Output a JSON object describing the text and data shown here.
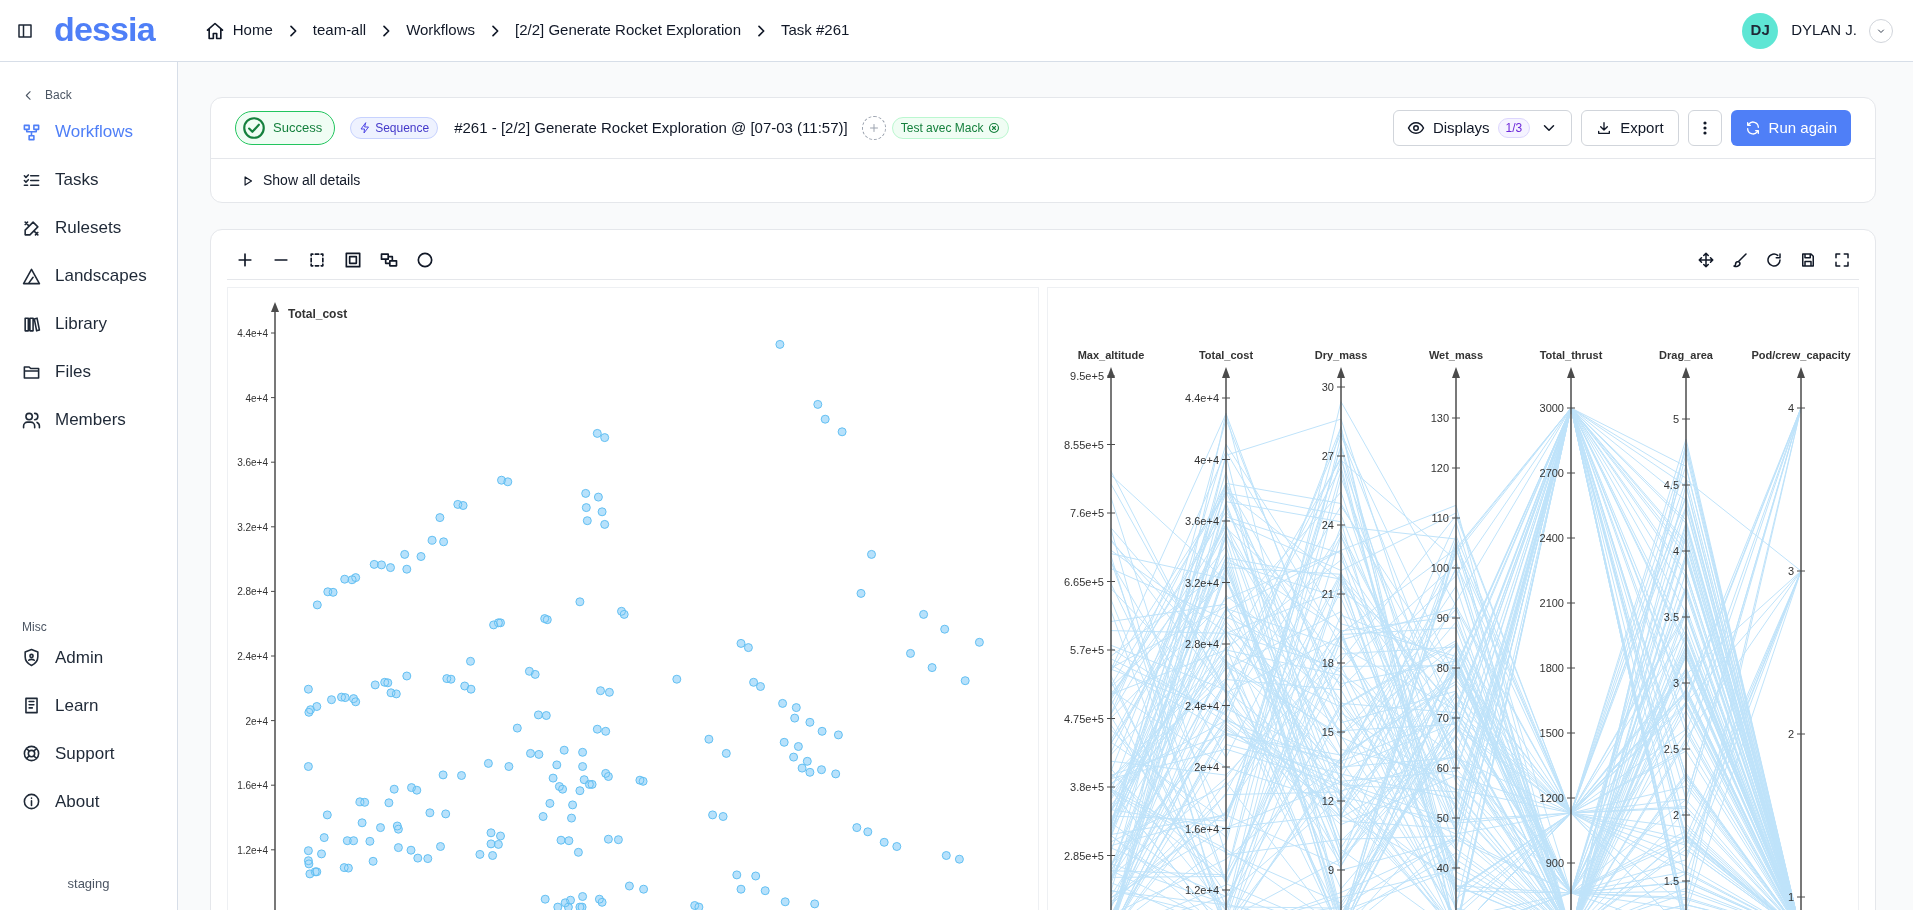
{
  "header": {
    "logo": "dessia",
    "breadcrumbs": [
      "Home",
      "team-all",
      "Workflows",
      "[2/2] Generate Rocket Exploration",
      "Task #261"
    ],
    "user": {
      "initials": "DJ",
      "name": "DYLAN J."
    }
  },
  "sidebar": {
    "back": "Back",
    "items": [
      {
        "label": "Workflows",
        "selected": true
      },
      {
        "label": "Tasks",
        "selected": false
      },
      {
        "label": "Rulesets",
        "selected": false
      },
      {
        "label": "Landscapes",
        "selected": false
      },
      {
        "label": "Library",
        "selected": false
      },
      {
        "label": "Files",
        "selected": false
      },
      {
        "label": "Members",
        "selected": false
      }
    ],
    "misc_title": "Misc",
    "misc_items": [
      "Admin",
      "Learn",
      "Support",
      "About"
    ],
    "environment": "staging"
  },
  "task": {
    "status": "Success",
    "type": "Sequence",
    "title": "#261 - [2/2] Generate Rocket Exploration @ [07-03 (11:57)]",
    "tags": [
      "Test avec Mack"
    ],
    "displays": {
      "label": "Displays",
      "count": "1/3"
    },
    "export": "Export",
    "run_again": "Run again",
    "details_toggle": "Show all details"
  },
  "scatter": {
    "ylabel": "Total_cost",
    "yticks": [
      "4.4e+4",
      "4e+4",
      "3.6e+4",
      "3.2e+4",
      "2.8e+4",
      "2.4e+4",
      "2e+4",
      "1.6e+4",
      "1.2e+4"
    ]
  },
  "parallel": {
    "axes": [
      {
        "name": "Max_altitude",
        "ticks": [
          "9.5e+5",
          "8.55e+5",
          "7.6e+5",
          "6.65e+5",
          "5.7e+5",
          "4.75e+5",
          "3.8e+5",
          "2.85e+5"
        ]
      },
      {
        "name": "Total_cost",
        "ticks": [
          "4.4e+4",
          "4e+4",
          "3.6e+4",
          "3.2e+4",
          "2.8e+4",
          "2.4e+4",
          "2e+4",
          "1.6e+4",
          "1.2e+4"
        ]
      },
      {
        "name": "Dry_mass",
        "ticks": [
          "30",
          "27",
          "24",
          "21",
          "18",
          "15",
          "12",
          "9"
        ]
      },
      {
        "name": "Wet_mass",
        "ticks": [
          "130",
          "120",
          "110",
          "100",
          "90",
          "80",
          "70",
          "60",
          "50",
          "40"
        ]
      },
      {
        "name": "Total_thrust",
        "ticks": [
          "3000",
          "2700",
          "2400",
          "2100",
          "1800",
          "1500",
          "1200",
          "900"
        ]
      },
      {
        "name": "Drag_area",
        "ticks": [
          "5",
          "4.5",
          "4",
          "3.5",
          "3",
          "2.5",
          "2",
          "1.5"
        ]
      },
      {
        "name": "Pod/crew_capacity",
        "ticks": [
          "4",
          "3",
          "2",
          "1"
        ]
      }
    ]
  }
}
